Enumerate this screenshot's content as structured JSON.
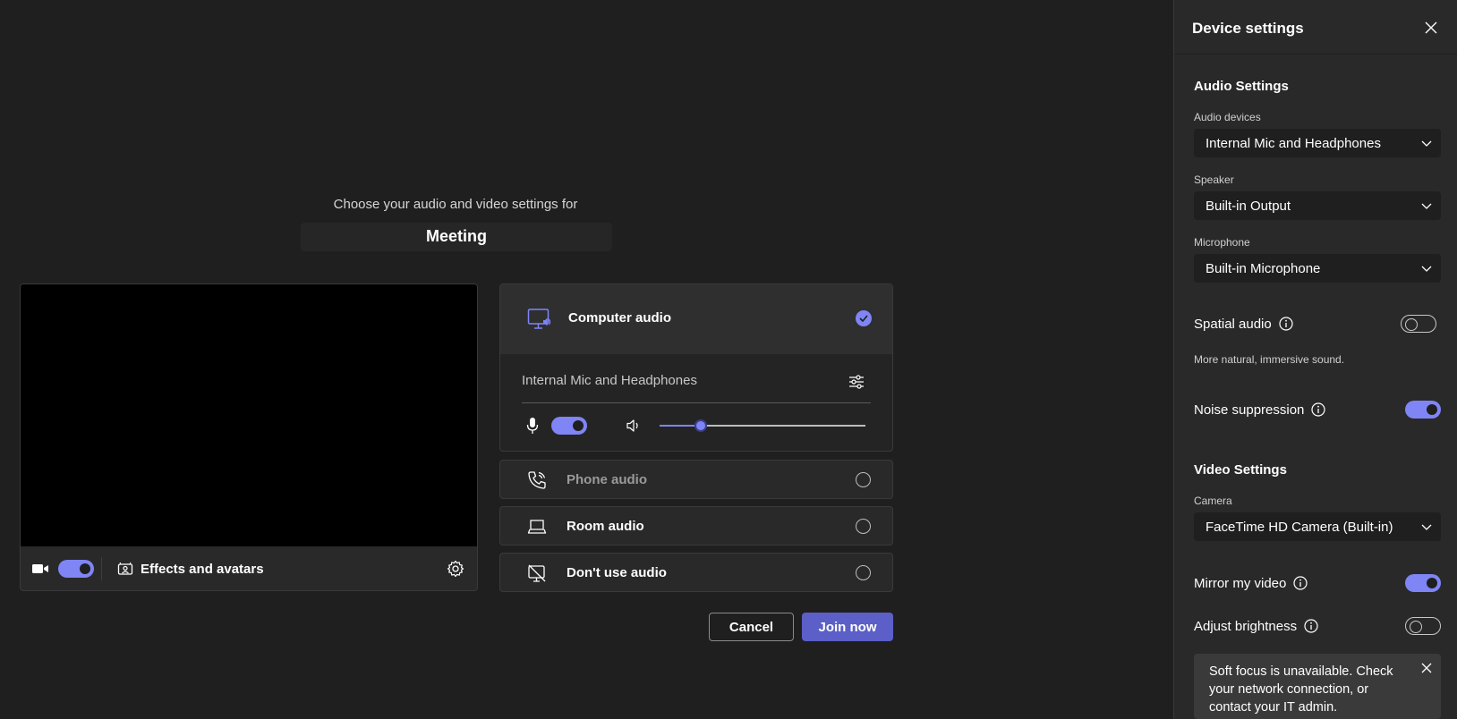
{
  "prejoin": {
    "choose_text": "Choose your audio and video settings for",
    "meeting_title": "Meeting"
  },
  "video": {
    "camera_on": true,
    "effects_label": "Effects and avatars"
  },
  "audio_options": {
    "computer": {
      "label": "Computer audio",
      "selected": true,
      "device_name": "Internal Mic and Headphones",
      "mic_on": true,
      "volume_level": 0.2
    },
    "phone": {
      "label": "Phone audio",
      "selected": false
    },
    "room": {
      "label": "Room audio",
      "selected": false
    },
    "none": {
      "label": "Don't use audio",
      "selected": false
    }
  },
  "actions": {
    "cancel_label": "Cancel",
    "join_label": "Join now"
  },
  "panel": {
    "title": "Device settings",
    "audio_section": "Audio Settings",
    "audio_devices_label": "Audio devices",
    "audio_devices_value": "Internal Mic and Headphones",
    "speaker_label": "Speaker",
    "speaker_value": "Built-in Output",
    "microphone_label": "Microphone",
    "microphone_value": "Built-in Microphone",
    "spatial_audio_label": "Spatial audio",
    "spatial_audio_on": false,
    "spatial_audio_desc": "More natural, immersive sound.",
    "noise_suppression_label": "Noise suppression",
    "noise_suppression_on": true,
    "video_section": "Video Settings",
    "camera_label": "Camera",
    "camera_value": "FaceTime HD Camera (Built-in)",
    "mirror_label": "Mirror my video",
    "mirror_on": true,
    "brightness_label": "Adjust brightness",
    "brightness_on": false,
    "banner_text": "Soft focus is unavailable. Check your network connection, or contact your IT admin."
  },
  "colors": {
    "accent": "#7f85f5",
    "primary_button": "#5b5fc7",
    "background": "#1f1f1f",
    "panel": "#292929"
  }
}
